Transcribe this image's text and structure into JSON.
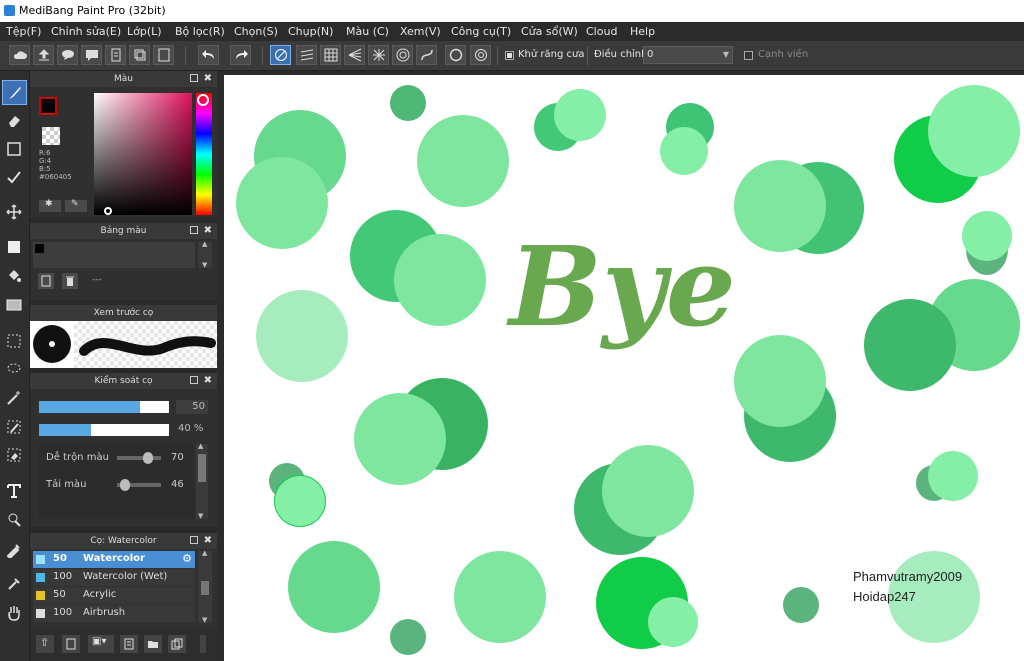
{
  "window": {
    "title": "MediBang Paint Pro (32bit)"
  },
  "menu": [
    "Tệp(F)",
    "Chỉnh sửa(E)",
    "Lớp(L)",
    "Bộ lọc(R)",
    "Chọn(S)",
    "Chụp(N)",
    "Màu (C)",
    "Xem(V)",
    "Công cụ(T)",
    "Cửa sổ(W)",
    "Cloud",
    "Help"
  ],
  "toolbar": {
    "antialias_label": "Khử răng cưa",
    "adjust_label": "Điều chỉnh",
    "adjust_value": "0",
    "edge_label": "Cạnh viền"
  },
  "color_panel": {
    "title": "Màu",
    "r": "R:6",
    "g": "G:4",
    "b": "B:5",
    "hex": "#060405",
    "primary_color": "#060405"
  },
  "palette_panel": {
    "title": "Bảng màu",
    "dash": "---"
  },
  "brush_preview_panel": {
    "title": "Xem trước cọ"
  },
  "brush_control_panel": {
    "title": "Kiểm soát cọ",
    "size_value": "50",
    "size_fraction": 0.78,
    "opacity_value": "40 %",
    "opacity_fraction": 0.4,
    "blend_label": "Dễ trộn màu",
    "blend_value": "70",
    "amount_label": "Tải màu",
    "amount_value": "46"
  },
  "brush_list_panel": {
    "title": "Cọ: Watercolor",
    "items": [
      {
        "size": "50",
        "name": "Watercolor",
        "color": "#4fb7e8"
      },
      {
        "size": "100",
        "name": "Watercolor (Wet)",
        "color": "#4fb7e8"
      },
      {
        "size": "50",
        "name": "Acrylic",
        "color": "#e6c229"
      },
      {
        "size": "100",
        "name": "Airbrush",
        "color": "#dddddd"
      }
    ]
  },
  "canvas": {
    "text": "Bye",
    "signature_line1": "Phamvutramy2009",
    "signature_line2": "Hoidap247",
    "accent_green": "#6aa84f"
  }
}
